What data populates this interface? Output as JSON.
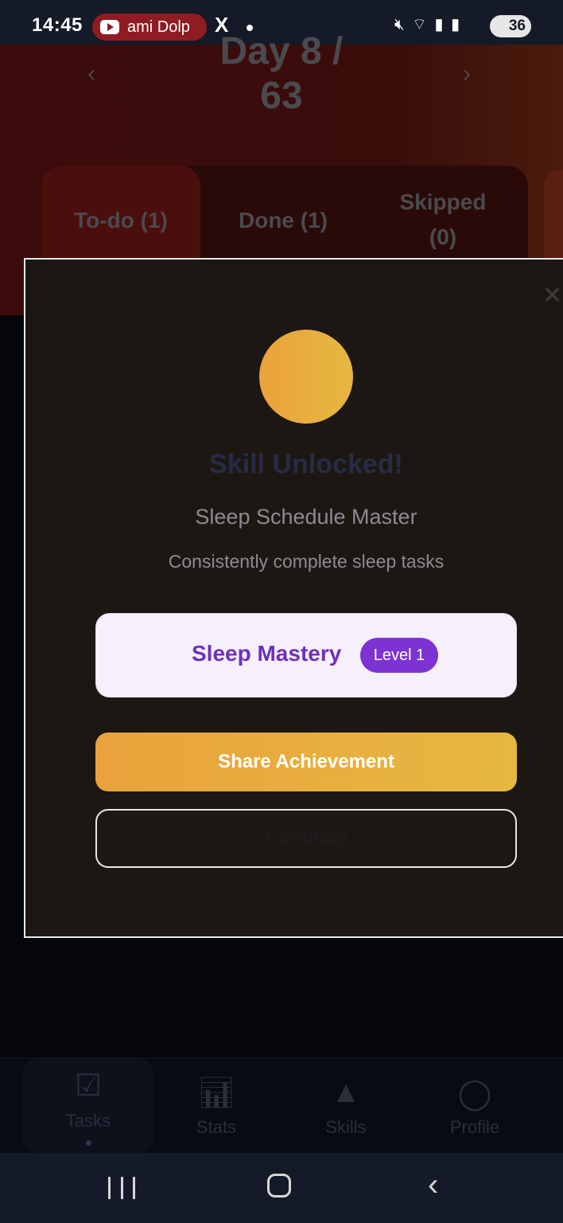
{
  "status_bar": {
    "time": "14:45",
    "notification_pill": "ami Dolp",
    "x_app": "X",
    "battery": "36",
    "icons": [
      "mute-icon",
      "wifi-icon",
      "signal-icon",
      "signal-icon"
    ]
  },
  "header": {
    "day_line1": "Day 8 /",
    "day_line2": "63",
    "prev_arrow": "‹",
    "next_arrow": "›"
  },
  "tabs": [
    {
      "label": "To-do (1)"
    },
    {
      "label": "Done (1)"
    },
    {
      "label": "Skipped (0)"
    }
  ],
  "dialog": {
    "close": "✕",
    "title": "Skill Unlocked!",
    "subtitle": "Sleep Schedule Master",
    "description": "Consistently complete sleep tasks",
    "skill_name": "Sleep Mastery",
    "level": "Level 1",
    "share_label": "Share Achievement",
    "continue_label": "Continue",
    "colors": {
      "accent": "#eaa23c",
      "purple": "#7d33d1"
    }
  },
  "bottom_nav": [
    {
      "label": "Tasks",
      "icon": "checkbox-icon"
    },
    {
      "label": "Stats",
      "icon": "bar-chart-icon"
    },
    {
      "label": "Skills",
      "icon": "tree-icon"
    },
    {
      "label": "Profile",
      "icon": "person-icon"
    }
  ]
}
